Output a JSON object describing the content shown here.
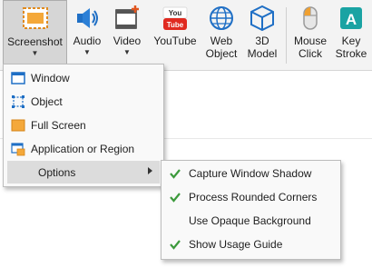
{
  "ribbon": {
    "buttons": [
      {
        "key": "screenshot",
        "label": "Screenshot",
        "has_dropdown": true,
        "active": true,
        "icon": "screenshot-icon"
      },
      {
        "key": "audio",
        "label": "Audio",
        "has_dropdown": true,
        "icon": "speaker-icon"
      },
      {
        "key": "video",
        "label": "Video",
        "has_dropdown": true,
        "icon": "film-icon"
      },
      {
        "key": "youtube",
        "label": "YouTube",
        "icon": "youtube-icon"
      },
      {
        "key": "web_object",
        "label_line1": "Web",
        "label_line2": "Object",
        "icon": "globe-icon"
      },
      {
        "key": "model_3d",
        "label_line1": "3D",
        "label_line2": "Model",
        "icon": "cube-icon"
      },
      {
        "key": "mouse_click",
        "label_line1": "Mouse",
        "label_line2": "Click",
        "icon": "mouse-icon"
      },
      {
        "key": "key_stroke",
        "label_line1": "Key",
        "label_line2": "Stroke",
        "icon": "key-a-icon"
      }
    ],
    "dropdown_arrow": "▼"
  },
  "menu": {
    "items": [
      {
        "label": "Window",
        "icon": "window-icon"
      },
      {
        "label": "Object",
        "icon": "object-select-icon"
      },
      {
        "label": "Full Screen",
        "icon": "full-screen-icon"
      },
      {
        "label": "Application or Region",
        "icon": "application-region-icon"
      },
      {
        "label": "Options",
        "has_submenu": true,
        "highlighted": true
      }
    ]
  },
  "submenu": {
    "items": [
      {
        "label": "Capture Window Shadow",
        "checked": true
      },
      {
        "label": "Process Rounded Corners",
        "checked": true
      },
      {
        "label": "Use Opaque Background",
        "checked": false
      },
      {
        "label": "Show Usage Guide",
        "checked": true
      }
    ]
  },
  "colors": {
    "accent_orange": "#f0a030",
    "blue": "#1f6fc5",
    "youtube_red": "#e02a20",
    "check_green": "#3c9a3c",
    "teal": "#1aa3a3"
  }
}
